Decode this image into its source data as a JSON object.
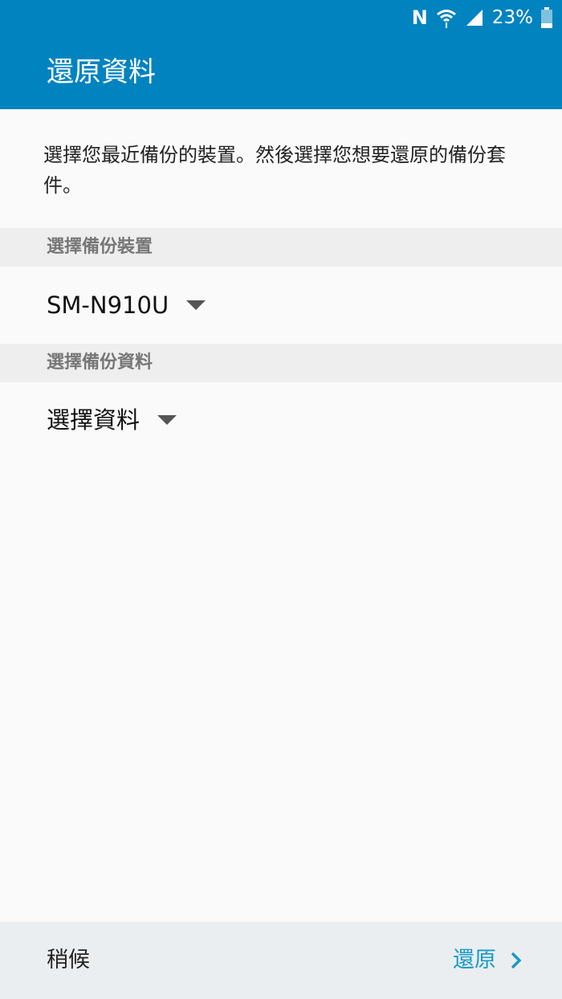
{
  "status_bar": {
    "nfc_icon": "nfc-icon",
    "battery_text": "23%"
  },
  "app_bar": {
    "title": "還原資料"
  },
  "description": "選擇您最近備份的裝置。然後選擇您想要還原的備份套件。",
  "device_section": {
    "header": "選擇備份裝置",
    "selected": "SM-N910U"
  },
  "data_section": {
    "header": "選擇備份資料",
    "selected": "選擇資料"
  },
  "bottom": {
    "later_label": "稍候",
    "restore_label": "還原"
  },
  "colors": {
    "primary": "#0183bf",
    "accent": "#1799c9",
    "section_bg": "#eeeeee",
    "bottom_bg": "#ebeef1"
  }
}
